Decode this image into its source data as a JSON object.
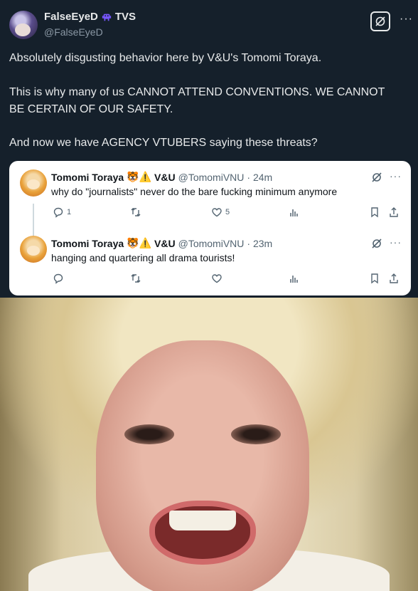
{
  "post": {
    "display_name": "FalseEyeD",
    "name_suffix": "TVS",
    "handle": "@FalseEyeD",
    "paragraphs": [
      "Absolutely disgusting behavior here by V&U's Tomomi Toraya.",
      "This is why many of us CANNOT ATTEND CONVENTIONS. WE CANNOT",
      "BE CERTAIN OF OUR SAFETY.",
      "And now we have AGENCY VTUBERS saying these threats?"
    ],
    "more_label": "···"
  },
  "quote": {
    "tweets": [
      {
        "name": "Tomomi Toraya",
        "emoji": "🐯⚠️",
        "group": "V&U",
        "handle": "@TomomiVNU",
        "time": "· 24m",
        "text": "why do \"journalists\" never do the bare fucking minimum anymore",
        "reply_count": "1",
        "retweet_count": "",
        "like_count": "5"
      },
      {
        "name": "Tomomi Toraya",
        "emoji": "🐯⚠️",
        "group": "V&U",
        "handle": "@TomomiVNU",
        "time": "· 23m",
        "text": "hanging and quartering all drama tourists!",
        "reply_count": "",
        "retweet_count": "",
        "like_count": ""
      }
    ],
    "more_label": "···"
  },
  "colors": {
    "background": "#15202b",
    "alien_icon": "#7856ff",
    "muted": "#536471"
  },
  "image": {
    "description_icon": "crying-face-photo"
  }
}
